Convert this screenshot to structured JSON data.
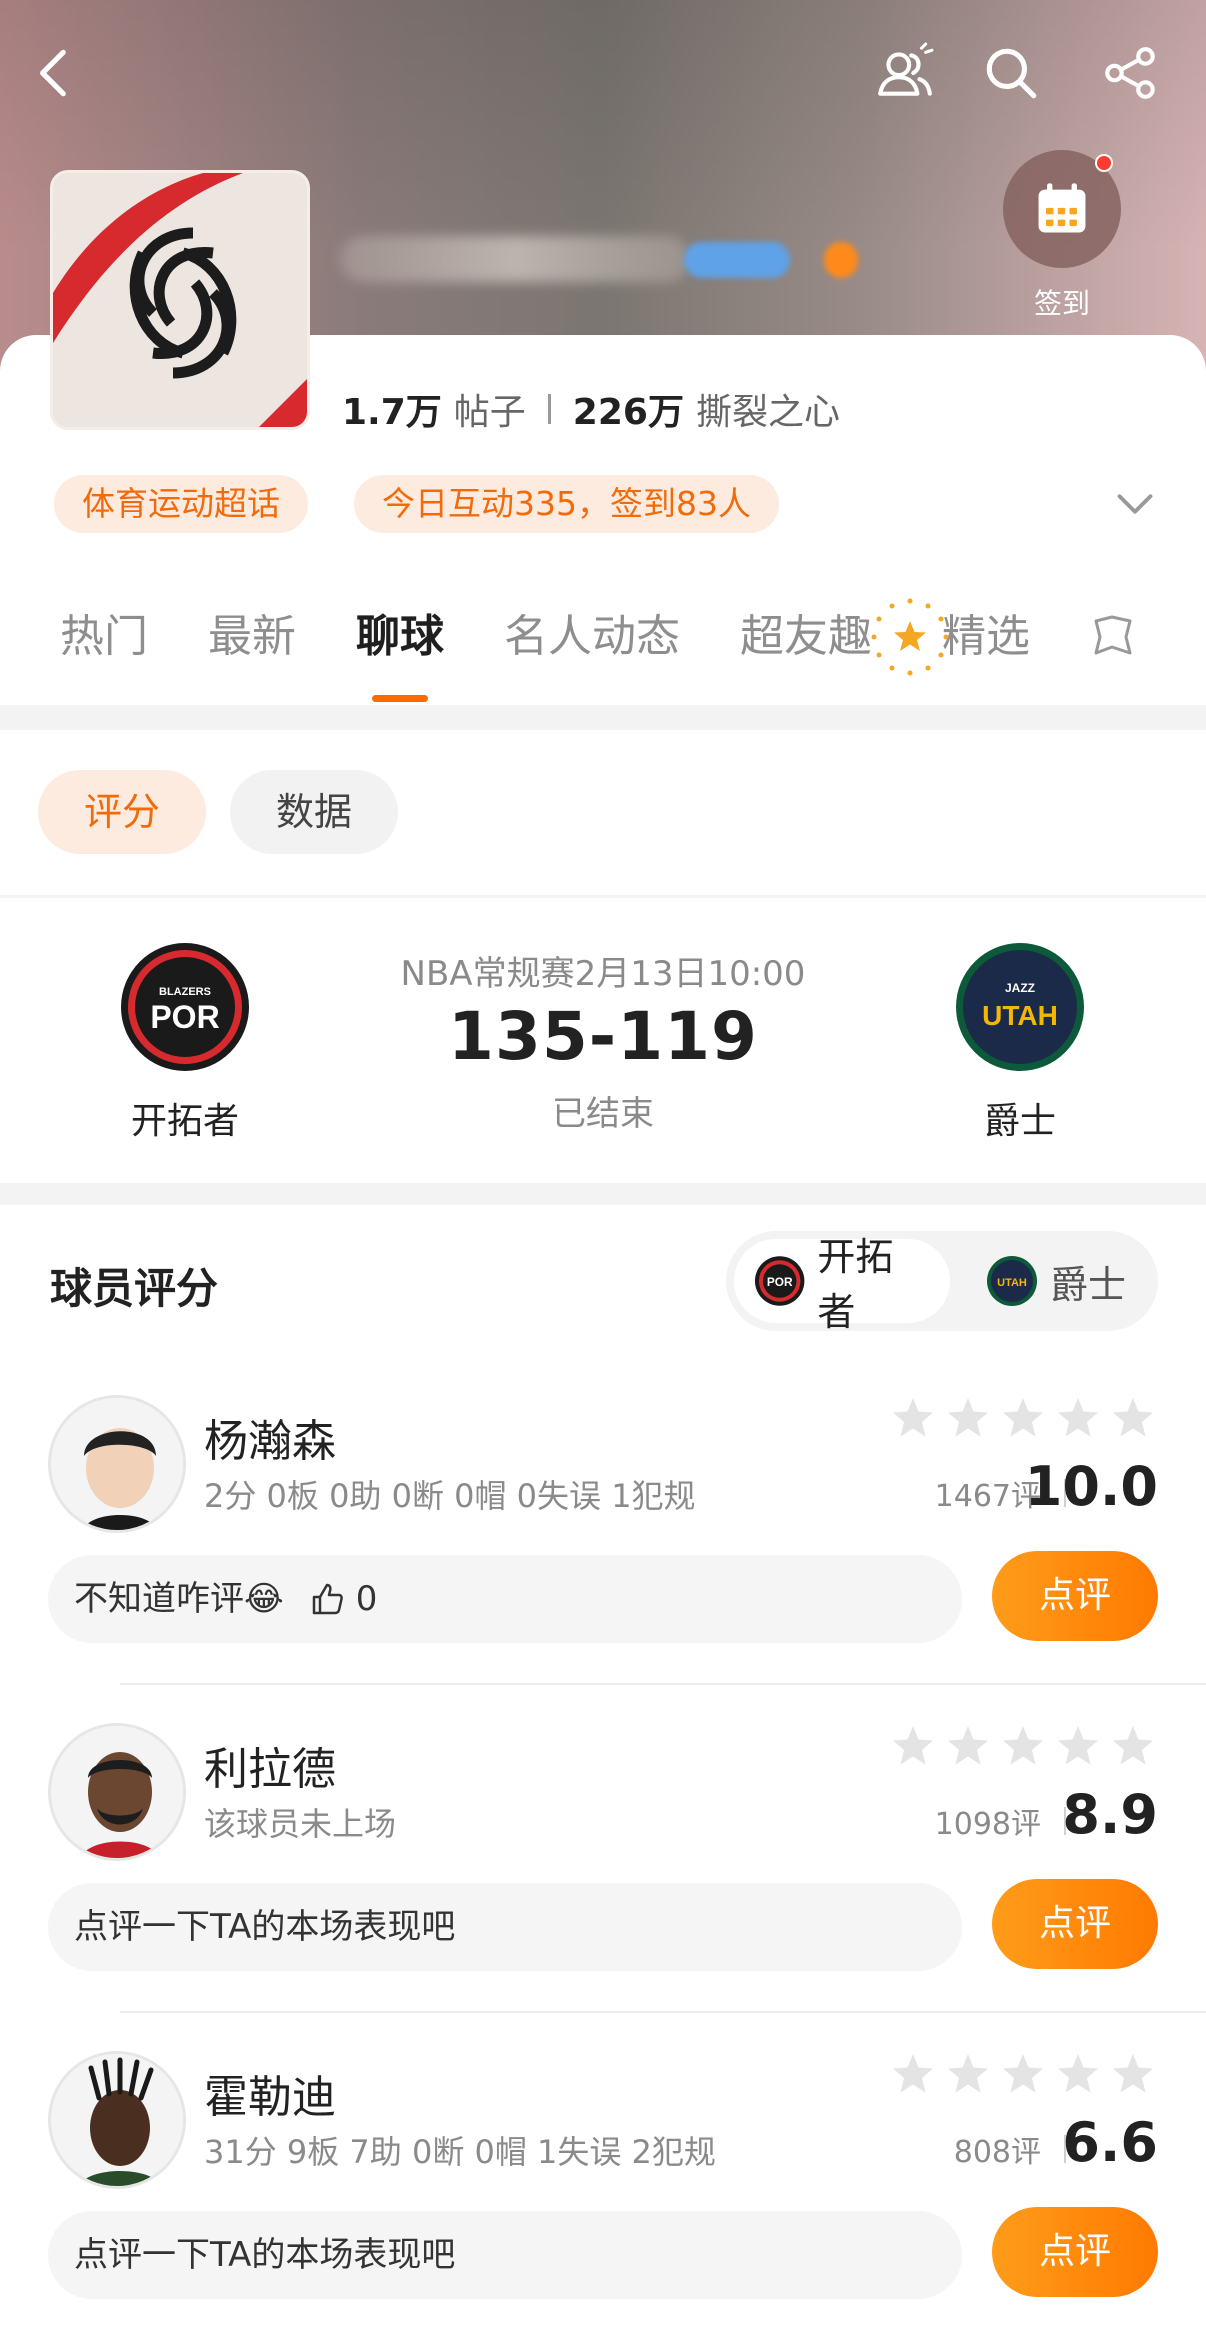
{
  "header": {
    "checkin_label": "签到",
    "stats": {
      "posts_value": "1.7万",
      "posts_label": "帖子",
      "fans_value": "226万",
      "fans_label": "撕裂之心"
    },
    "tags": [
      "体育运动超话",
      "今日互动335，签到83人"
    ]
  },
  "tabs": [
    "热门",
    "最新",
    "聊球",
    "名人动态",
    "超友趣",
    "精选"
  ],
  "active_tab": "聊球",
  "filter_chips": {
    "active": "评分",
    "other": "数据"
  },
  "match": {
    "home_team": "开拓者",
    "away_team": "爵士",
    "home_logo_text": "POR",
    "home_logo_small": "BLAZERS",
    "away_logo_text": "UTAH",
    "away_logo_small": "JAZZ",
    "meta": "NBA常规赛2月13日10:00",
    "score": "135-119",
    "status": "已结束"
  },
  "ratings": {
    "title": "球员评分",
    "switch_active": "开拓者",
    "switch_other": "爵士",
    "button_label": "点评",
    "players": [
      {
        "name": "杨瀚森",
        "stats": "2分 0板 0助 0断 0帽 0失误 1犯规",
        "count": "1467评",
        "score": "10.0",
        "comment": "不知道咋评😂",
        "likes": "0"
      },
      {
        "name": "利拉德",
        "stats": "该球员未上场",
        "count": "1098评",
        "score": "8.9",
        "comment": "点评一下TA的本场表现吧"
      },
      {
        "name": "霍勒迪",
        "stats": "31分 9板 7助 0断 0帽 1失误 2犯规",
        "count": "808评",
        "score": "6.6",
        "comment": "点评一下TA的本场表现吧"
      }
    ]
  },
  "colors": {
    "accent": "#ff7a00",
    "accent_soft": "#fdebe0",
    "blazers_red": "#d72a2f",
    "jazz_navy": "#1c2a4a",
    "jazz_gold": "#f5b700"
  }
}
